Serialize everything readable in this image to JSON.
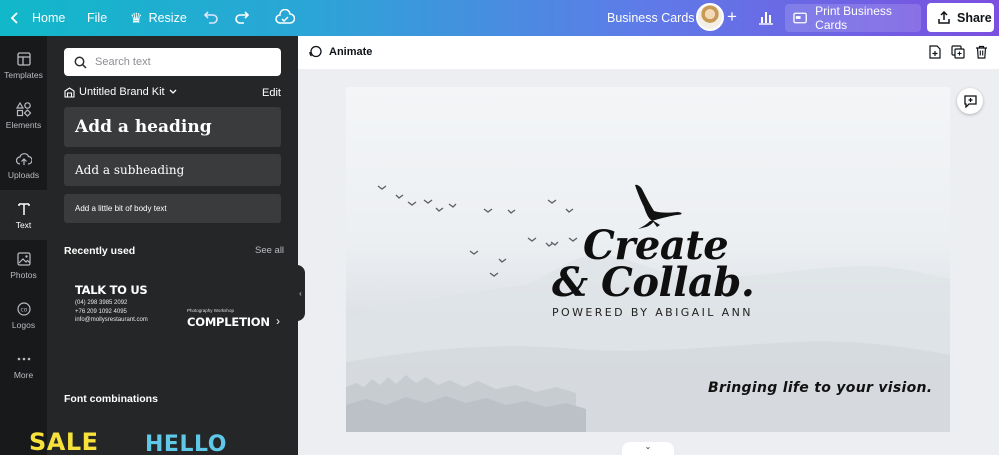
{
  "topbar": {
    "home_label": "Home",
    "file_label": "File",
    "resize_label": "Resize",
    "doc_title": "Business Cards",
    "print_label": "Print Business Cards",
    "share_label": "Share"
  },
  "leftnav": {
    "items": [
      {
        "label": "Templates",
        "icon": "templates-icon"
      },
      {
        "label": "Elements",
        "icon": "elements-icon"
      },
      {
        "label": "Uploads",
        "icon": "uploads-icon"
      },
      {
        "label": "Text",
        "icon": "text-icon"
      },
      {
        "label": "Photos",
        "icon": "photos-icon"
      },
      {
        "label": "Logos",
        "icon": "logos-icon"
      },
      {
        "label": "More",
        "icon": "more-icon"
      }
    ],
    "active": "Text"
  },
  "panel": {
    "search_placeholder": "Search text",
    "brand_kit": "Untitled Brand Kit",
    "edit_label": "Edit",
    "heading": "Add a heading",
    "subheading": "Add a subheading",
    "body": "Add a little bit of body text",
    "recently_used": "Recently used",
    "see_all": "See all",
    "recent1": {
      "title": "TALK TO US",
      "lines": [
        "(04) 298 3985 2092",
        "+76 209 1092 4095",
        "info@mollysrestaurant.com"
      ]
    },
    "recent2": {
      "overline": "Photography Workshop",
      "title": "COMPLETION"
    },
    "font_combinations": "Font combinations",
    "combo1": "SALE",
    "combo2": "HELLO"
  },
  "editor": {
    "animate_label": "Animate"
  },
  "canvas": {
    "line1": "Create",
    "line2": "& Collab.",
    "powered_by": "POWERED BY ABIGAIL ANN",
    "tagline": "Bringing life to your vision."
  },
  "colors": {
    "topbar_start": "#11b8c9",
    "topbar_end": "#7b4fe0",
    "panel_bg": "#252627",
    "nav_bg": "#18191b",
    "combo1": "#f7e23b",
    "combo2": "#5fc8e8"
  }
}
